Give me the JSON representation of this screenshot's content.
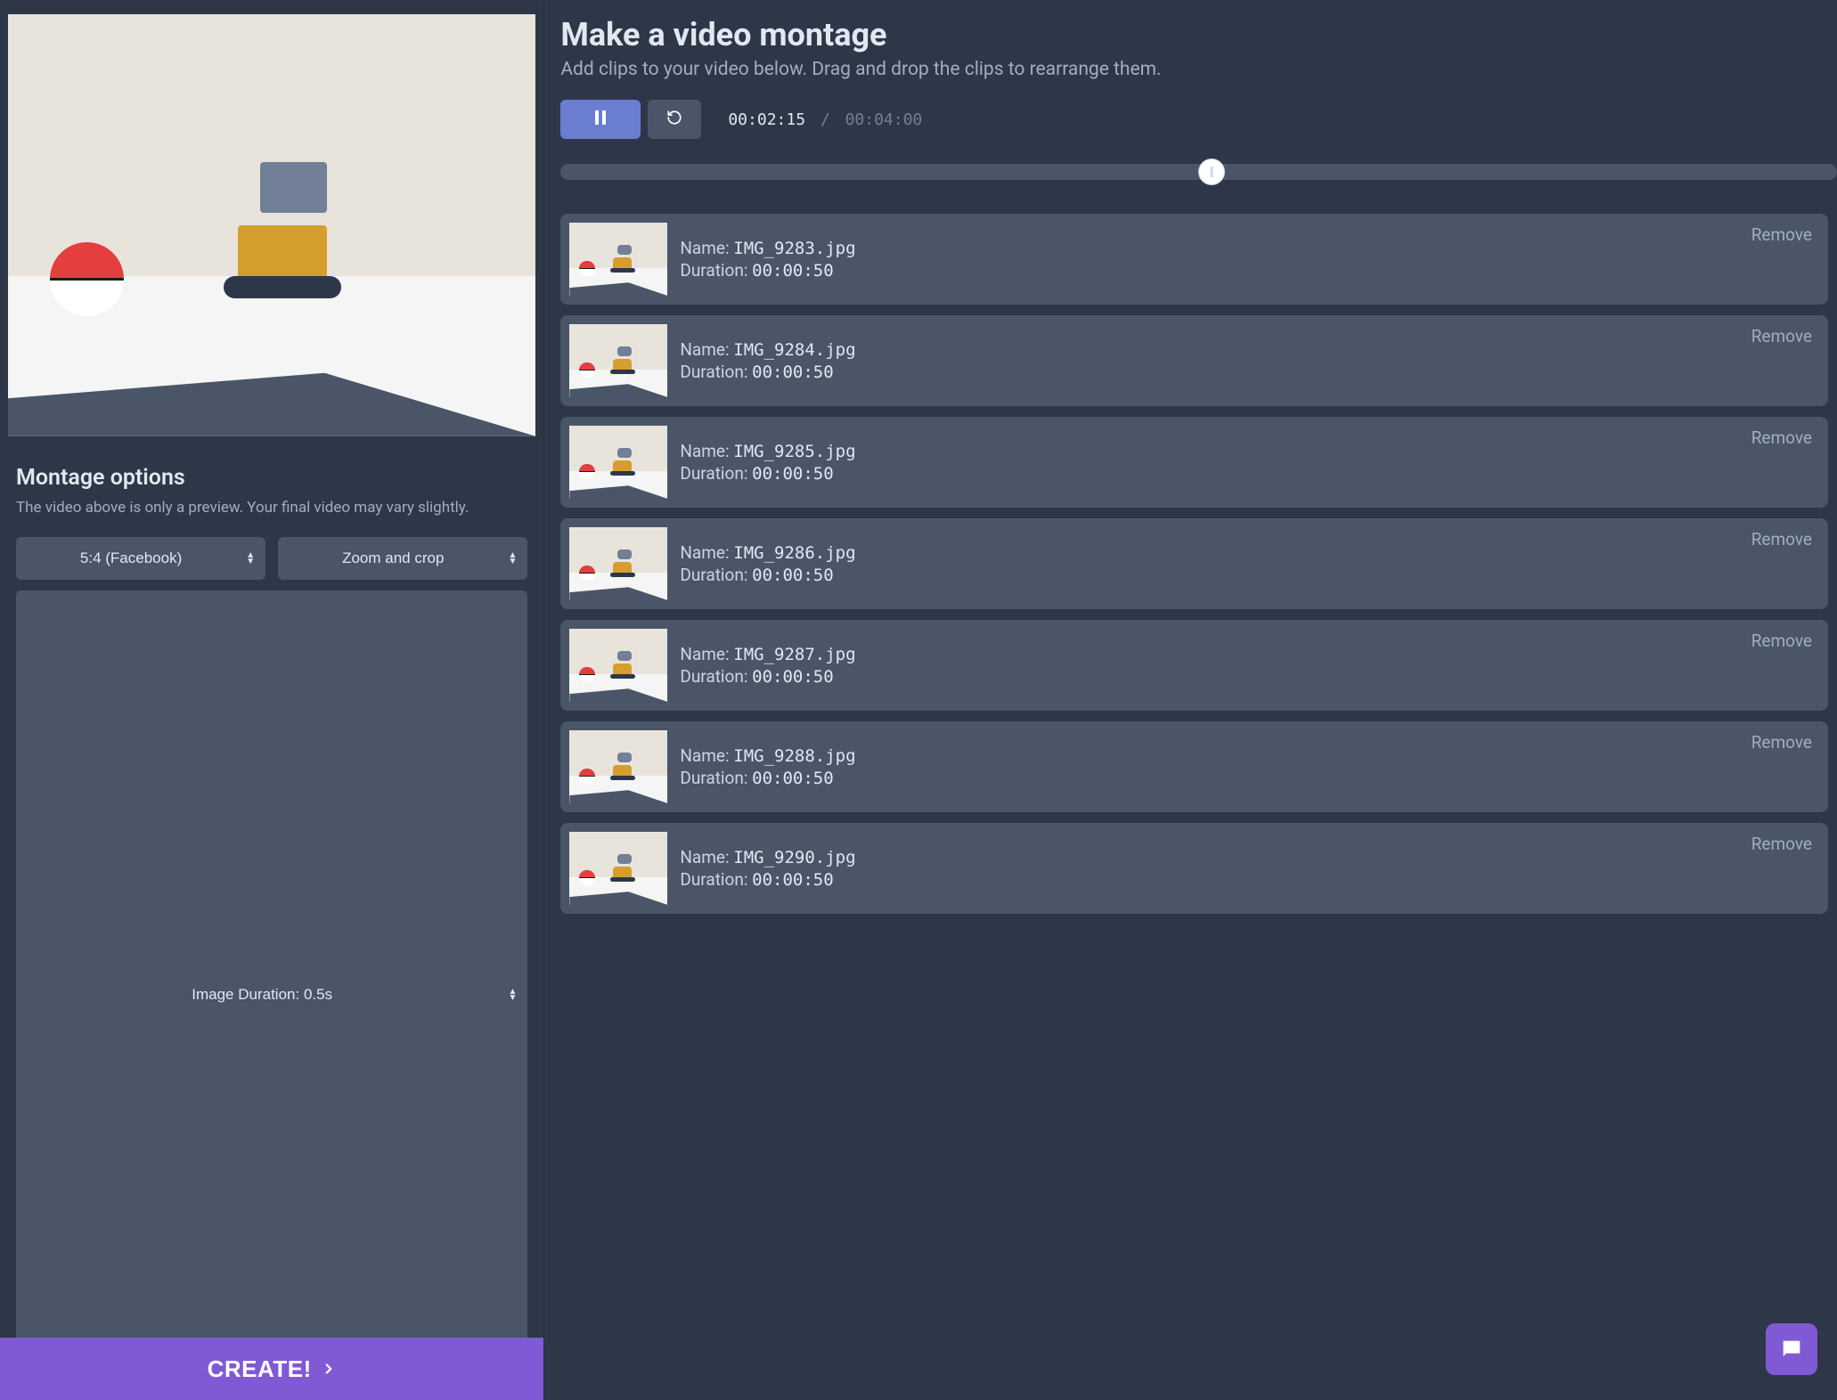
{
  "sidebar": {
    "options_heading": "Montage options",
    "options_desc": "The video above is only a preview. Your final video may vary slightly.",
    "aspect_select": "5:4 (Facebook)",
    "fit_select": "Zoom and crop",
    "duration_select": "Image Duration: 0.5s",
    "create_label": "CREATE!"
  },
  "main": {
    "title": "Make a video montage",
    "desc": "Add clips to your video below. Drag and drop the clips to rearrange them.",
    "time_current": "00:02:15",
    "time_sep": "/",
    "time_total": "00:04:00",
    "scrub_percent": 51,
    "labels": {
      "name": "Name:",
      "duration": "Duration:",
      "remove": "Remove"
    },
    "clips": [
      {
        "name": "IMG_9283.jpg",
        "duration": "00:00:50"
      },
      {
        "name": "IMG_9284.jpg",
        "duration": "00:00:50"
      },
      {
        "name": "IMG_9285.jpg",
        "duration": "00:00:50"
      },
      {
        "name": "IMG_9286.jpg",
        "duration": "00:00:50"
      },
      {
        "name": "IMG_9287.jpg",
        "duration": "00:00:50"
      },
      {
        "name": "IMG_9288.jpg",
        "duration": "00:00:50"
      },
      {
        "name": "IMG_9290.jpg",
        "duration": "00:00:50"
      }
    ]
  }
}
